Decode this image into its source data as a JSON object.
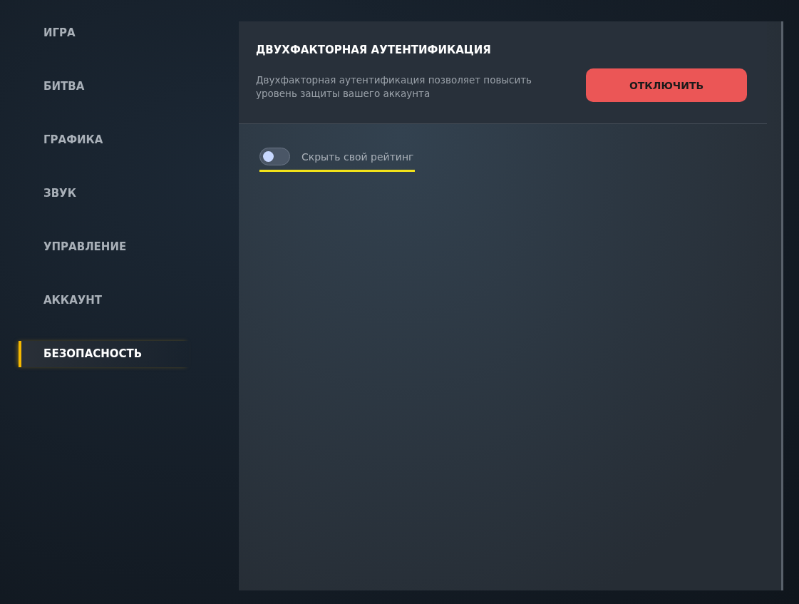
{
  "sidebar": {
    "items": [
      {
        "label": "ИГРА",
        "selected": false
      },
      {
        "label": "БИТВА",
        "selected": false
      },
      {
        "label": "ГРАФИКА",
        "selected": false
      },
      {
        "label": "ЗВУК",
        "selected": false
      },
      {
        "label": "УПРАВЛЕНИЕ",
        "selected": false
      },
      {
        "label": "АККАУНТ",
        "selected": false
      },
      {
        "label": "БЕЗОПАСНОСТЬ",
        "selected": true
      }
    ]
  },
  "two_factor": {
    "title": "ДВУХФАКТОРНАЯ АУТЕНТИФИКАЦИЯ",
    "description": "Двухфакторная аутентификация позволяет повысить уровень защиты вашего аккаунта",
    "button": "ОТКЛЮЧИТЬ"
  },
  "hide_rating": {
    "label": "Скрыть свой рейтинг",
    "on": false,
    "focused": true
  }
}
